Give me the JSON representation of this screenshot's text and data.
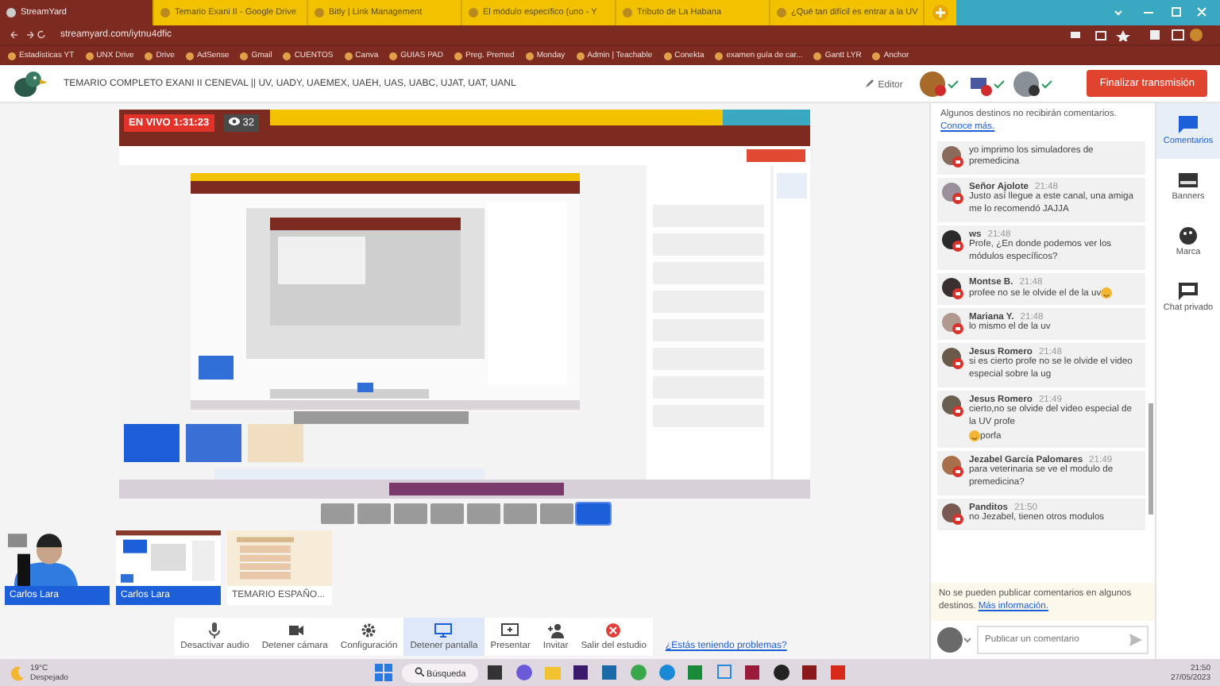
{
  "browser": {
    "tabs": [
      {
        "title": "StreamYard",
        "selected": true
      },
      {
        "title": "Temario Exani II - Google Drive",
        "selected": false
      },
      {
        "title": "Bitly | Link Management",
        "selected": false
      },
      {
        "title": "El módulo específico (uno - Y",
        "selected": false
      },
      {
        "title": "Tributo de La Habana",
        "selected": false
      },
      {
        "title": "¿Qué tan difícil es entrar a la UV",
        "selected": false
      }
    ],
    "address": "streamyard.com/iytnu4dfic",
    "bookmarks": [
      "Estadísticas YT",
      "UNX Drive",
      "Drive",
      "AdSense",
      "Gmail",
      "CUENTOS",
      "Canva",
      "GUIAS PAD",
      "Preg. Premed",
      "Monday",
      "Admin | Teachable",
      "Conekta",
      "examen guía de car...",
      "Gantt LYR",
      "Anchor"
    ]
  },
  "header": {
    "title": "TEMARIO COMPLETO EXANI II CENEVAL || UV, UADY, UAEMEX, UAEH, UAS, UABC, UJAT, UAT, UANL",
    "editor": "Editor",
    "end_button": "Finalizar transmisión"
  },
  "stage": {
    "live_badge": "EN VIVO 1:31:23",
    "viewers": "32"
  },
  "layouts": [
    {
      "selected": false
    },
    {
      "selected": false
    },
    {
      "selected": false
    },
    {
      "selected": false
    },
    {
      "selected": false
    },
    {
      "selected": false
    },
    {
      "selected": false
    },
    {
      "selected": true
    }
  ],
  "sources": [
    {
      "kind": "camera",
      "name": "Carlos Lara"
    },
    {
      "kind": "screen",
      "name": "Carlos Lara"
    },
    {
      "kind": "slide",
      "name": "TEMARIO ESPAÑO..."
    }
  ],
  "toolbar": [
    {
      "kind": "mic",
      "label": "Desactivar audio",
      "selected": false
    },
    {
      "kind": "camera",
      "label": "Detener cámara",
      "selected": false
    },
    {
      "kind": "gear",
      "label": "Configuración",
      "selected": false
    },
    {
      "kind": "screen",
      "label": "Detener pantalla",
      "selected": true
    },
    {
      "kind": "present",
      "label": "Presentar",
      "selected": false
    },
    {
      "kind": "invite",
      "label": "Invitar",
      "selected": false
    },
    {
      "kind": "exit",
      "label": "Salir del estudio",
      "selected": false
    }
  ],
  "help_link": "¿Estás teniendo problemas?",
  "chat": {
    "notice": "Algunos destinos no recibirán comentarios.",
    "notice_link": "Conoce más.",
    "messages": [
      {
        "text": "yo imprimo los simuladores de premedicina"
      },
      {
        "author": "Señor Ajolote",
        "time": "21:48",
        "text": "Justo así llegue a este canal, una amiga me lo recomendó JAJJA"
      },
      {
        "author": "ws",
        "time": "21:48",
        "text": "Profe, ¿En donde podemos ver los módulos específicos?"
      },
      {
        "author": "Montse B.",
        "time": "21:48",
        "text": "profee no se le olvide el de la uv",
        "emoji": true
      },
      {
        "author": "Mariana Y.",
        "time": "21:48",
        "text": "lo mismo el de la uv"
      },
      {
        "author": "Jesus Romero",
        "time": "21:48",
        "text": "si es cierto profe no se le olvide el video especial sobre la ug"
      },
      {
        "author": "Jesus Romero",
        "time": "21:49",
        "text": "cierto,no se olvide del video especial de la UV profe",
        "emoji": true,
        "text_after": "porfa"
      },
      {
        "author": "Jezabel García Palomares",
        "time": "21:49",
        "text": "para veterinaria se ve el modulo de premedicina?"
      },
      {
        "author": "Panditos",
        "time": "21:50",
        "text": "no Jezabel, tienen otros modulos"
      }
    ],
    "footer_notice": "No se pueden publicar comentarios en algunos destinos.",
    "footer_link": "Más información.",
    "placeholder": "Publicar un comentario"
  },
  "rail": [
    {
      "kind": "comments",
      "label": "Comentarios",
      "selected": true
    },
    {
      "kind": "banners",
      "label": "Banners",
      "selected": false
    },
    {
      "kind": "brand",
      "label": "Marca",
      "selected": false
    },
    {
      "kind": "private",
      "label": "Chat privado",
      "selected": false
    }
  ],
  "taskbar": {
    "temperature": "19°C",
    "weather": "Despejado",
    "search": "Búsqueda",
    "time": "21:50",
    "date": "27/05/2023"
  }
}
